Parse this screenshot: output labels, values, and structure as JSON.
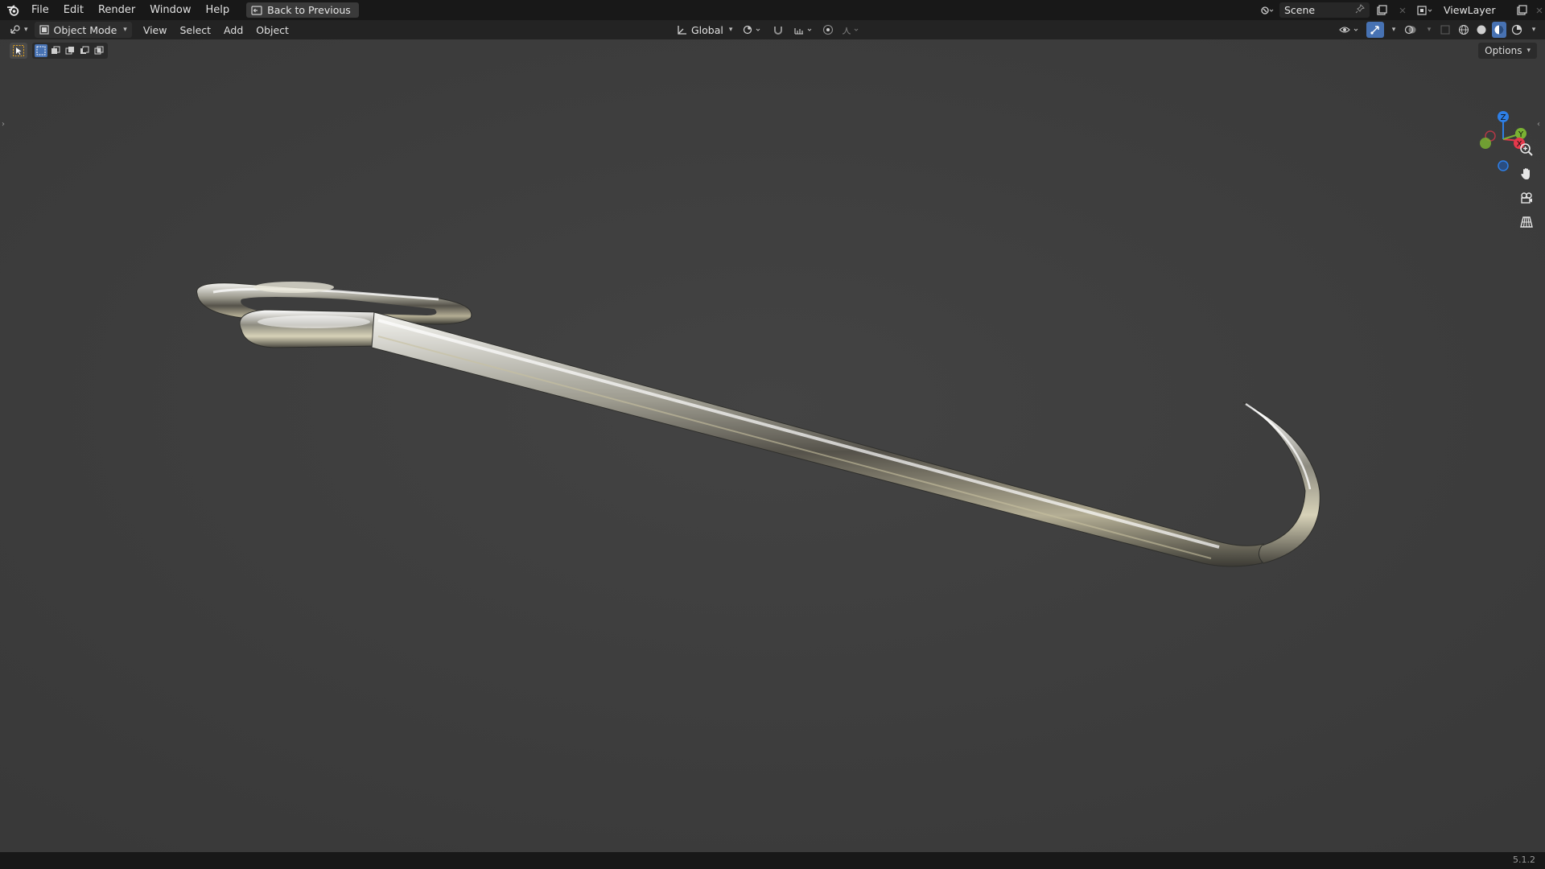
{
  "app": {
    "menu": [
      "File",
      "Edit",
      "Render",
      "Window",
      "Help"
    ],
    "back_button": "Back to Previous",
    "scene_name": "Scene",
    "view_layer": "ViewLayer"
  },
  "header": {
    "mode": "Object Mode",
    "menus": [
      "View",
      "Select",
      "Add",
      "Object"
    ],
    "orientation": "Global",
    "options_label": "Options"
  },
  "gizmo": {
    "x_label": "X",
    "y_label": "Y",
    "z_label": "Z",
    "colors": {
      "x": "#e5384b",
      "y": "#7ab233",
      "z": "#2e7fe6"
    }
  },
  "status": {
    "version": "5.1.2"
  },
  "theme": {
    "viewport_bg": "#3d3d3d",
    "accent": "#4772b3"
  }
}
